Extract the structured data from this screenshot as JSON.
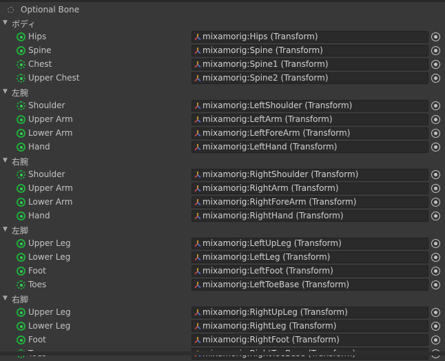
{
  "legend": {
    "label": "Optional Bone"
  },
  "groups": [
    {
      "name": "ボディ",
      "bones": [
        {
          "label": "Hips",
          "optional": false,
          "value": "mixamorig:Hips (Transform)"
        },
        {
          "label": "Spine",
          "optional": false,
          "value": "mixamorig:Spine (Transform)"
        },
        {
          "label": "Chest",
          "optional": true,
          "value": "mixamorig:Spine1 (Transform)"
        },
        {
          "label": "Upper Chest",
          "optional": true,
          "value": "mixamorig:Spine2 (Transform)"
        }
      ]
    },
    {
      "name": "左腕",
      "bones": [
        {
          "label": "Shoulder",
          "optional": true,
          "value": "mixamorig:LeftShoulder (Transform)"
        },
        {
          "label": "Upper Arm",
          "optional": false,
          "value": "mixamorig:LeftArm (Transform)"
        },
        {
          "label": "Lower Arm",
          "optional": false,
          "value": "mixamorig:LeftForeArm (Transform)"
        },
        {
          "label": "Hand",
          "optional": false,
          "value": "mixamorig:LeftHand (Transform)"
        }
      ]
    },
    {
      "name": "右腕",
      "bones": [
        {
          "label": "Shoulder",
          "optional": true,
          "value": "mixamorig:RightShoulder (Transform)"
        },
        {
          "label": "Upper Arm",
          "optional": false,
          "value": "mixamorig:RightArm (Transform)"
        },
        {
          "label": "Lower Arm",
          "optional": false,
          "value": "mixamorig:RightForeArm (Transform)"
        },
        {
          "label": "Hand",
          "optional": false,
          "value": "mixamorig:RightHand (Transform)"
        }
      ]
    },
    {
      "name": "左脚",
      "bones": [
        {
          "label": "Upper Leg",
          "optional": false,
          "value": "mixamorig:LeftUpLeg (Transform)"
        },
        {
          "label": "Lower Leg",
          "optional": false,
          "value": "mixamorig:LeftLeg (Transform)"
        },
        {
          "label": "Foot",
          "optional": false,
          "value": "mixamorig:LeftFoot (Transform)"
        },
        {
          "label": "Toes",
          "optional": true,
          "value": "mixamorig:LeftToeBase (Transform)"
        }
      ]
    },
    {
      "name": "右脚",
      "bones": [
        {
          "label": "Upper Leg",
          "optional": false,
          "value": "mixamorig:RightUpLeg (Transform)"
        },
        {
          "label": "Lower Leg",
          "optional": false,
          "value": "mixamorig:RightLeg (Transform)"
        },
        {
          "label": "Foot",
          "optional": false,
          "value": "mixamorig:RightFoot (Transform)"
        },
        {
          "label": "Toes",
          "optional": true,
          "value": "mixamorig:RightToeBase (Transform)"
        }
      ]
    }
  ],
  "icons": {
    "expand": "triangle-down-icon",
    "bone_required": "bone-status-dot-icon",
    "bone_optional": "optional-bone-dotted-ring-icon",
    "transform": "transform-axes-icon",
    "picker": "object-picker-icon"
  },
  "colors": {
    "background": "#383838",
    "field": "#2a2a2a",
    "status_green": "#1fae3a"
  }
}
